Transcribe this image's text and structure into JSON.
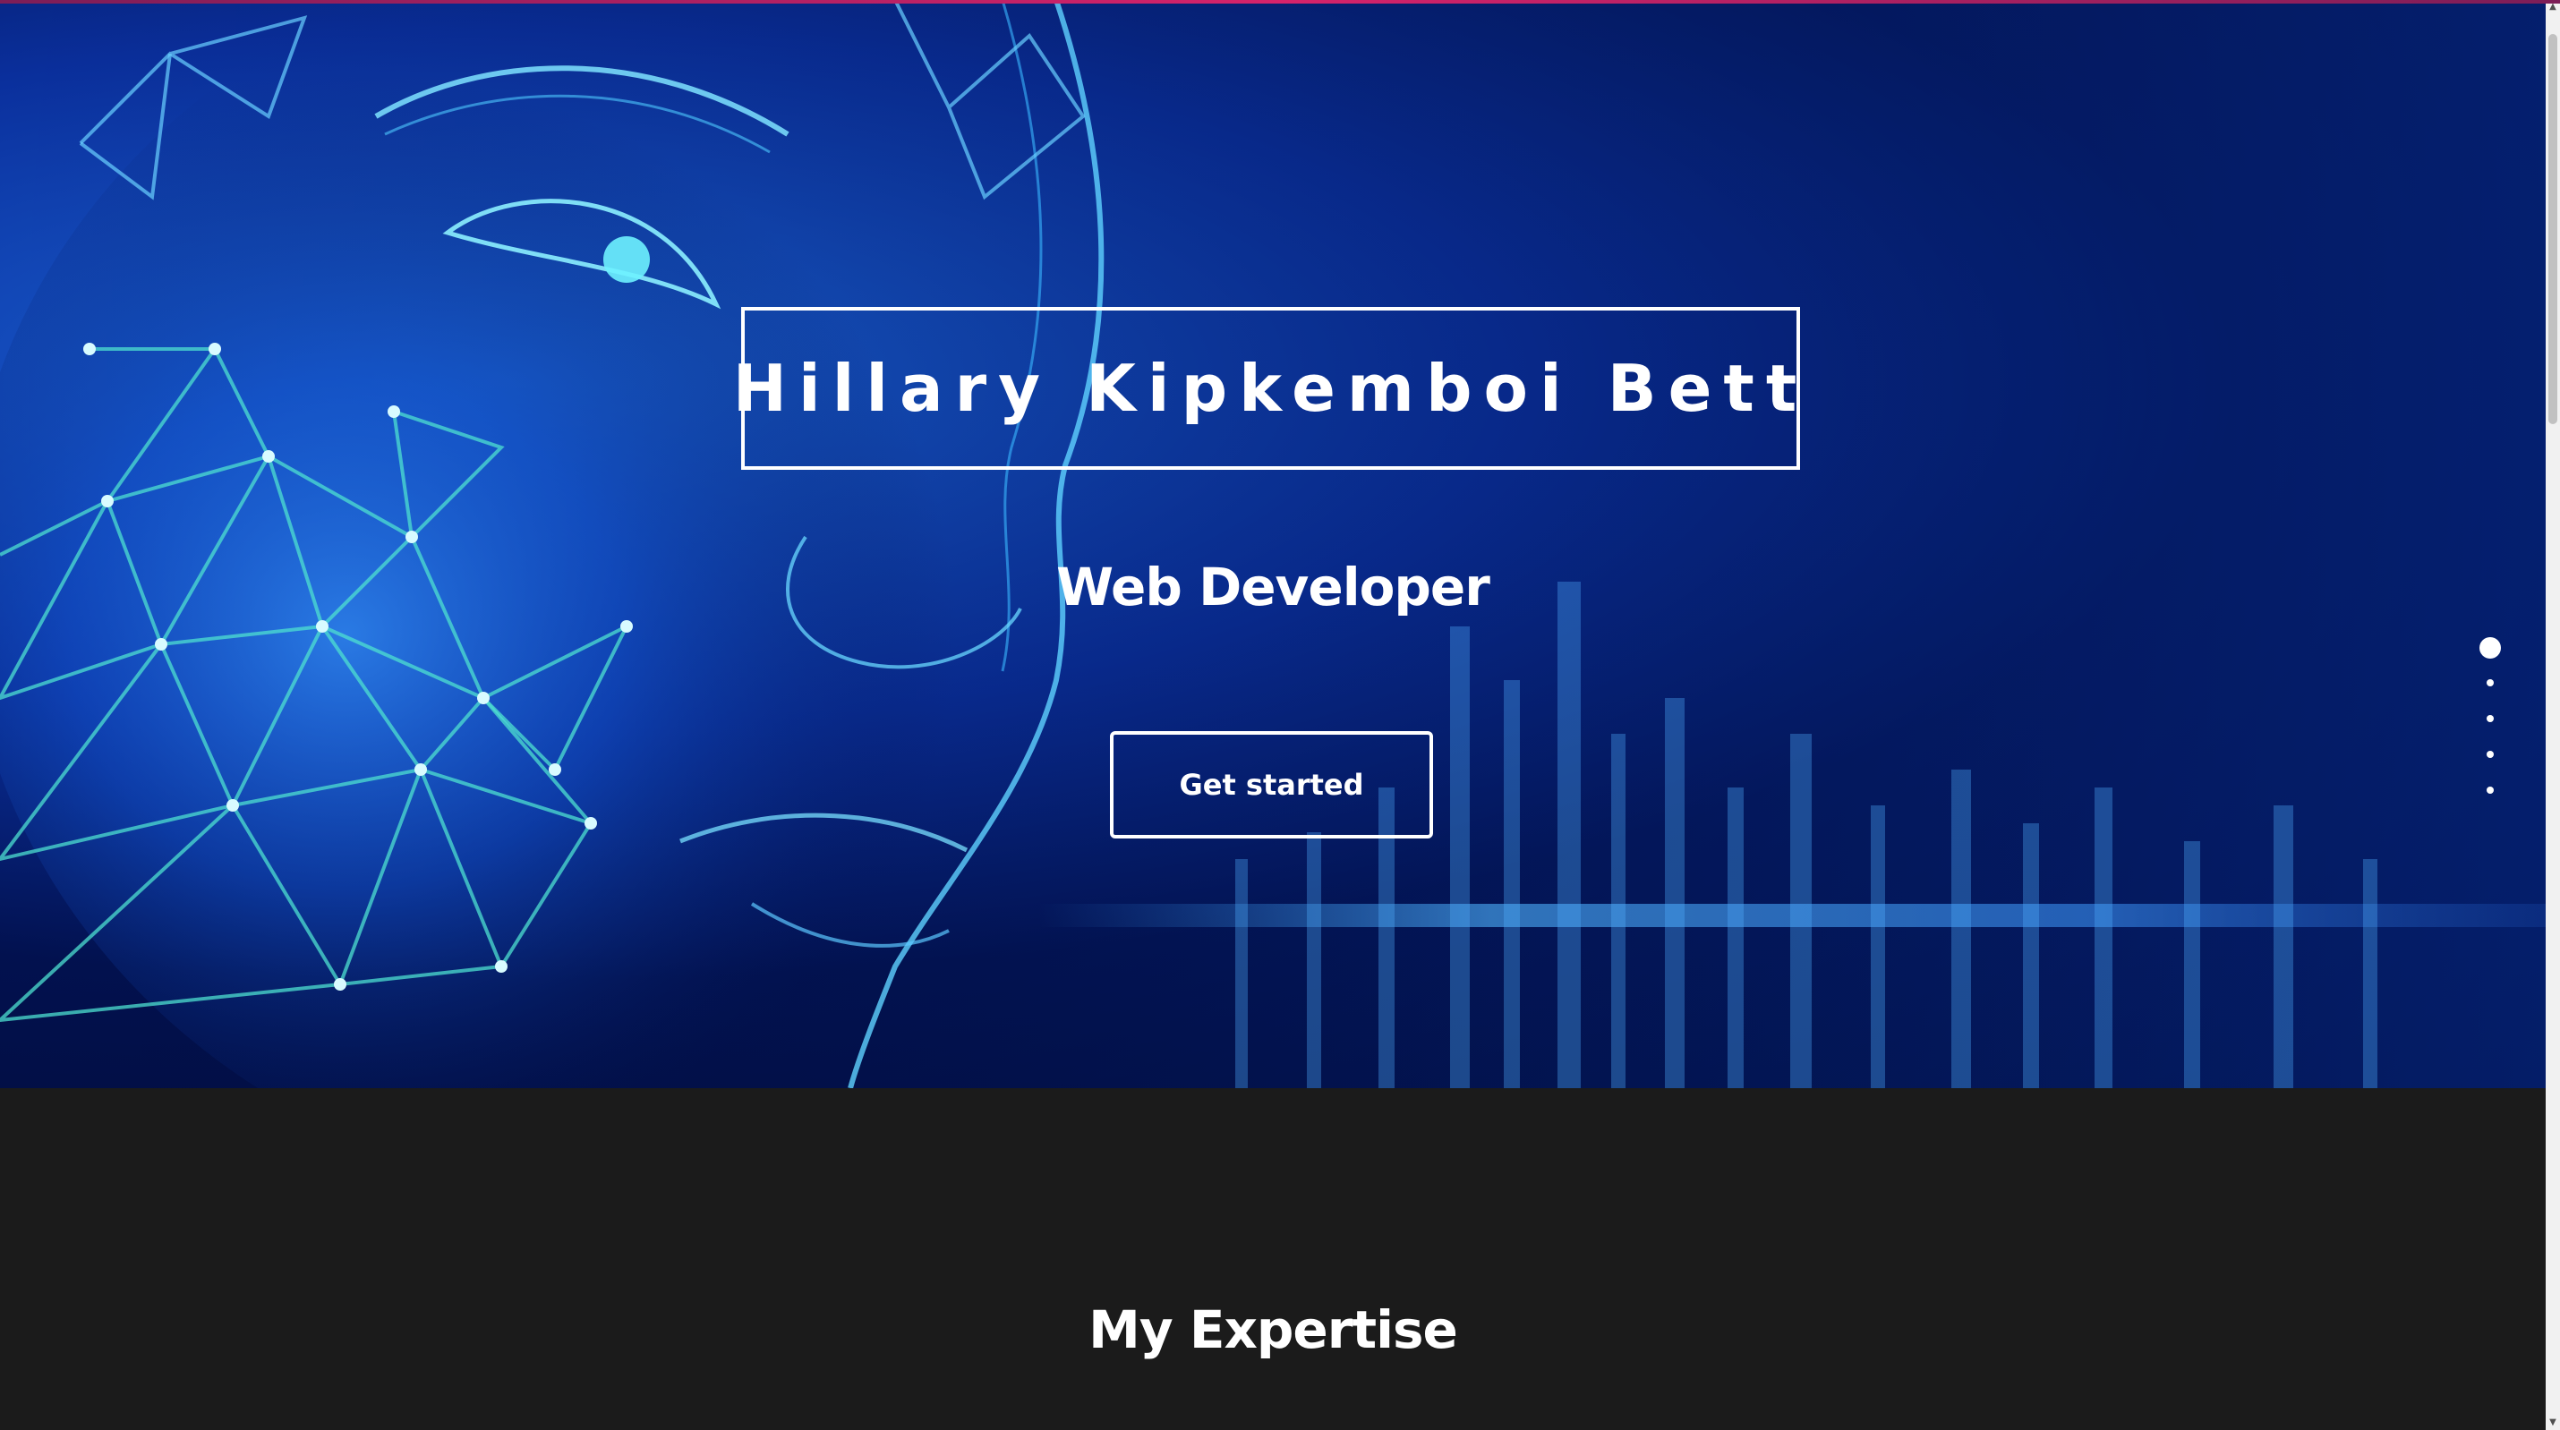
{
  "hero": {
    "title": "Hillary Kipkemboi Bett",
    "subtitle": "Web Developer",
    "cta_label": "Get started",
    "background_image": "ai-face-network-blue-soundwave",
    "dot_nav": {
      "count": 5,
      "active_index": 0
    }
  },
  "expertise": {
    "heading": "My Expertise"
  },
  "colors": {
    "accent_bar": "#d6236b",
    "hero_blue": "#0a2f9c",
    "section_bg": "#1b1b1b",
    "text": "#ffffff"
  },
  "scrollbar": {
    "up_icon": "chevron-up-icon",
    "down_icon": "chevron-down-icon"
  }
}
